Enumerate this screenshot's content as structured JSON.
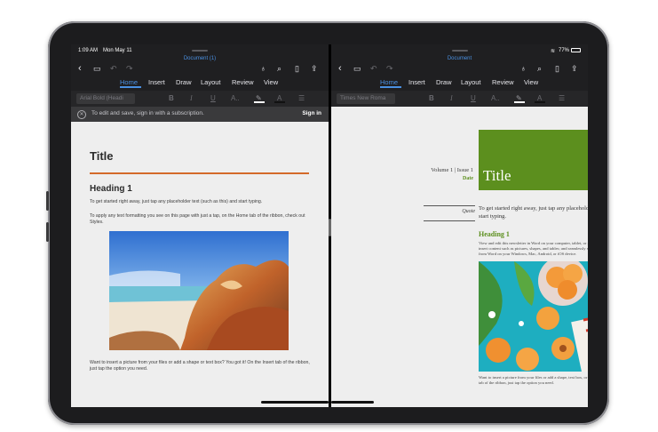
{
  "status": {
    "time": "1:09 AM",
    "date": "Mon May 11",
    "battery": "77%"
  },
  "left": {
    "doc_title": "Document (1)",
    "tabs": [
      "Home",
      "Insert",
      "Draw",
      "Layout",
      "Review",
      "View"
    ],
    "font": "Arial Bold (Headi",
    "notice": "To edit and save, sign in with a subscription.",
    "sign_in": "Sign in",
    "title": "Title",
    "heading": "Heading 1",
    "para1": "To get started right away, just tap any placeholder text (such as this) and start typing.",
    "para2": "To apply any text formatting you see on this page with just a tap, on the Home tab of the ribbon, check out Styles.",
    "para3": "Want to insert a picture from your files or add a shape or text box? You got it! On the Insert tab of the ribbon, just tap the option you need."
  },
  "right": {
    "doc_title": "Document",
    "tabs": [
      "Home",
      "Insert",
      "Draw",
      "Layout",
      "Review",
      "View"
    ],
    "font": "Times New Roma",
    "volume": "Volume 1 | Issue 1",
    "date": "Date",
    "title": "Title",
    "quote": "Quote",
    "intro": "To get started right away, just tap any placeholder text (such as this) and start typing.",
    "heading": "Heading 1",
    "para1": "View and edit this newsletter in Word on your computer, tablet, or phone. You can edit text; easily insert content such as pictures, shapes, and tables; and seamlessly save the document to the cloud from Word on your Windows, Mac, Android, or iOS device.",
    "para2": "Want to insert a picture from your files or add a shape, text box, or table? You got it! On the Insert tab of the ribbon, just tap the option you need."
  },
  "icons": [
    "back-icon",
    "file-icon",
    "undo-icon",
    "redo-icon",
    "lightbulb-icon",
    "search-icon",
    "phone-view-icon",
    "share-icon",
    "wifi-icon",
    "battery-icon"
  ],
  "colors": {
    "accent": "#4a90e2",
    "left_rule": "#d46a2a",
    "right_green": "#5c8f1e"
  }
}
